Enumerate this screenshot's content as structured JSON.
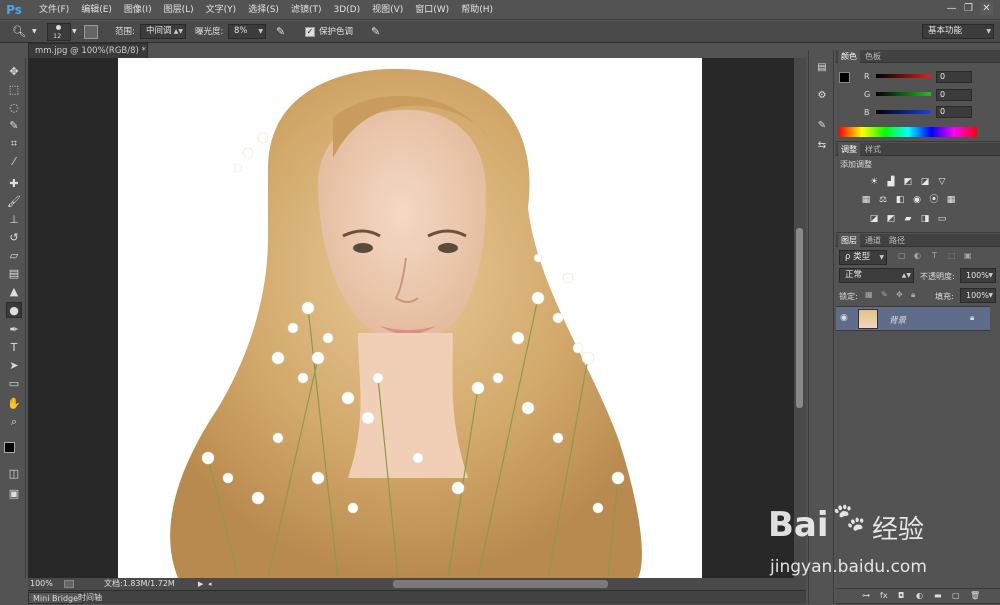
{
  "app": {
    "logo": "Ps"
  },
  "menu": [
    "文件(F)",
    "编辑(E)",
    "图像(I)",
    "图层(L)",
    "文字(Y)",
    "选择(S)",
    "滤镜(T)",
    "3D(D)",
    "视图(V)",
    "窗口(W)",
    "帮助(H)"
  ],
  "window_controls": {
    "minimize": "—",
    "restore": "❐",
    "close": "✕"
  },
  "options": {
    "brush_size": "12",
    "range_label": "范围:",
    "range_value": "中间调",
    "exposure_label": "曝光度:",
    "exposure_value": "8%",
    "protect_tones_label": "保护色调",
    "protect_tones_checked": true,
    "workspace": "基本功能"
  },
  "document": {
    "tab_title": "mm.jpg @ 100%(RGB/8)",
    "tab_modified": "*",
    "zoom": "100%",
    "doc_size": "文档:1.83M/1.72M"
  },
  "bottom_tabs": [
    "Mini Bridge",
    "时间轴"
  ],
  "color_panel": {
    "tabs": [
      "颜色",
      "色板"
    ],
    "channels": [
      {
        "label": "R",
        "value": "0"
      },
      {
        "label": "G",
        "value": "0"
      },
      {
        "label": "B",
        "value": "0"
      }
    ],
    "channel_colors": [
      "#e02020",
      "#20c020",
      "#2040e0"
    ]
  },
  "adjustments_panel": {
    "tabs": [
      "调整",
      "样式"
    ],
    "title": "添加调整"
  },
  "layers_panel": {
    "tabs": [
      "图层",
      "通道",
      "路径"
    ],
    "filter_kind": "ρ 类型",
    "blend_mode": "正常",
    "opacity_label": "不透明度:",
    "opacity_value": "100%",
    "lock_label": "锁定:",
    "fill_label": "填充:",
    "fill_value": "100%",
    "layers": [
      {
        "name": "背景",
        "visible": true,
        "locked": true
      }
    ]
  },
  "watermark": {
    "brand": "Bai",
    "brand2": "经验",
    "url": "jingyan.baidu.com"
  }
}
